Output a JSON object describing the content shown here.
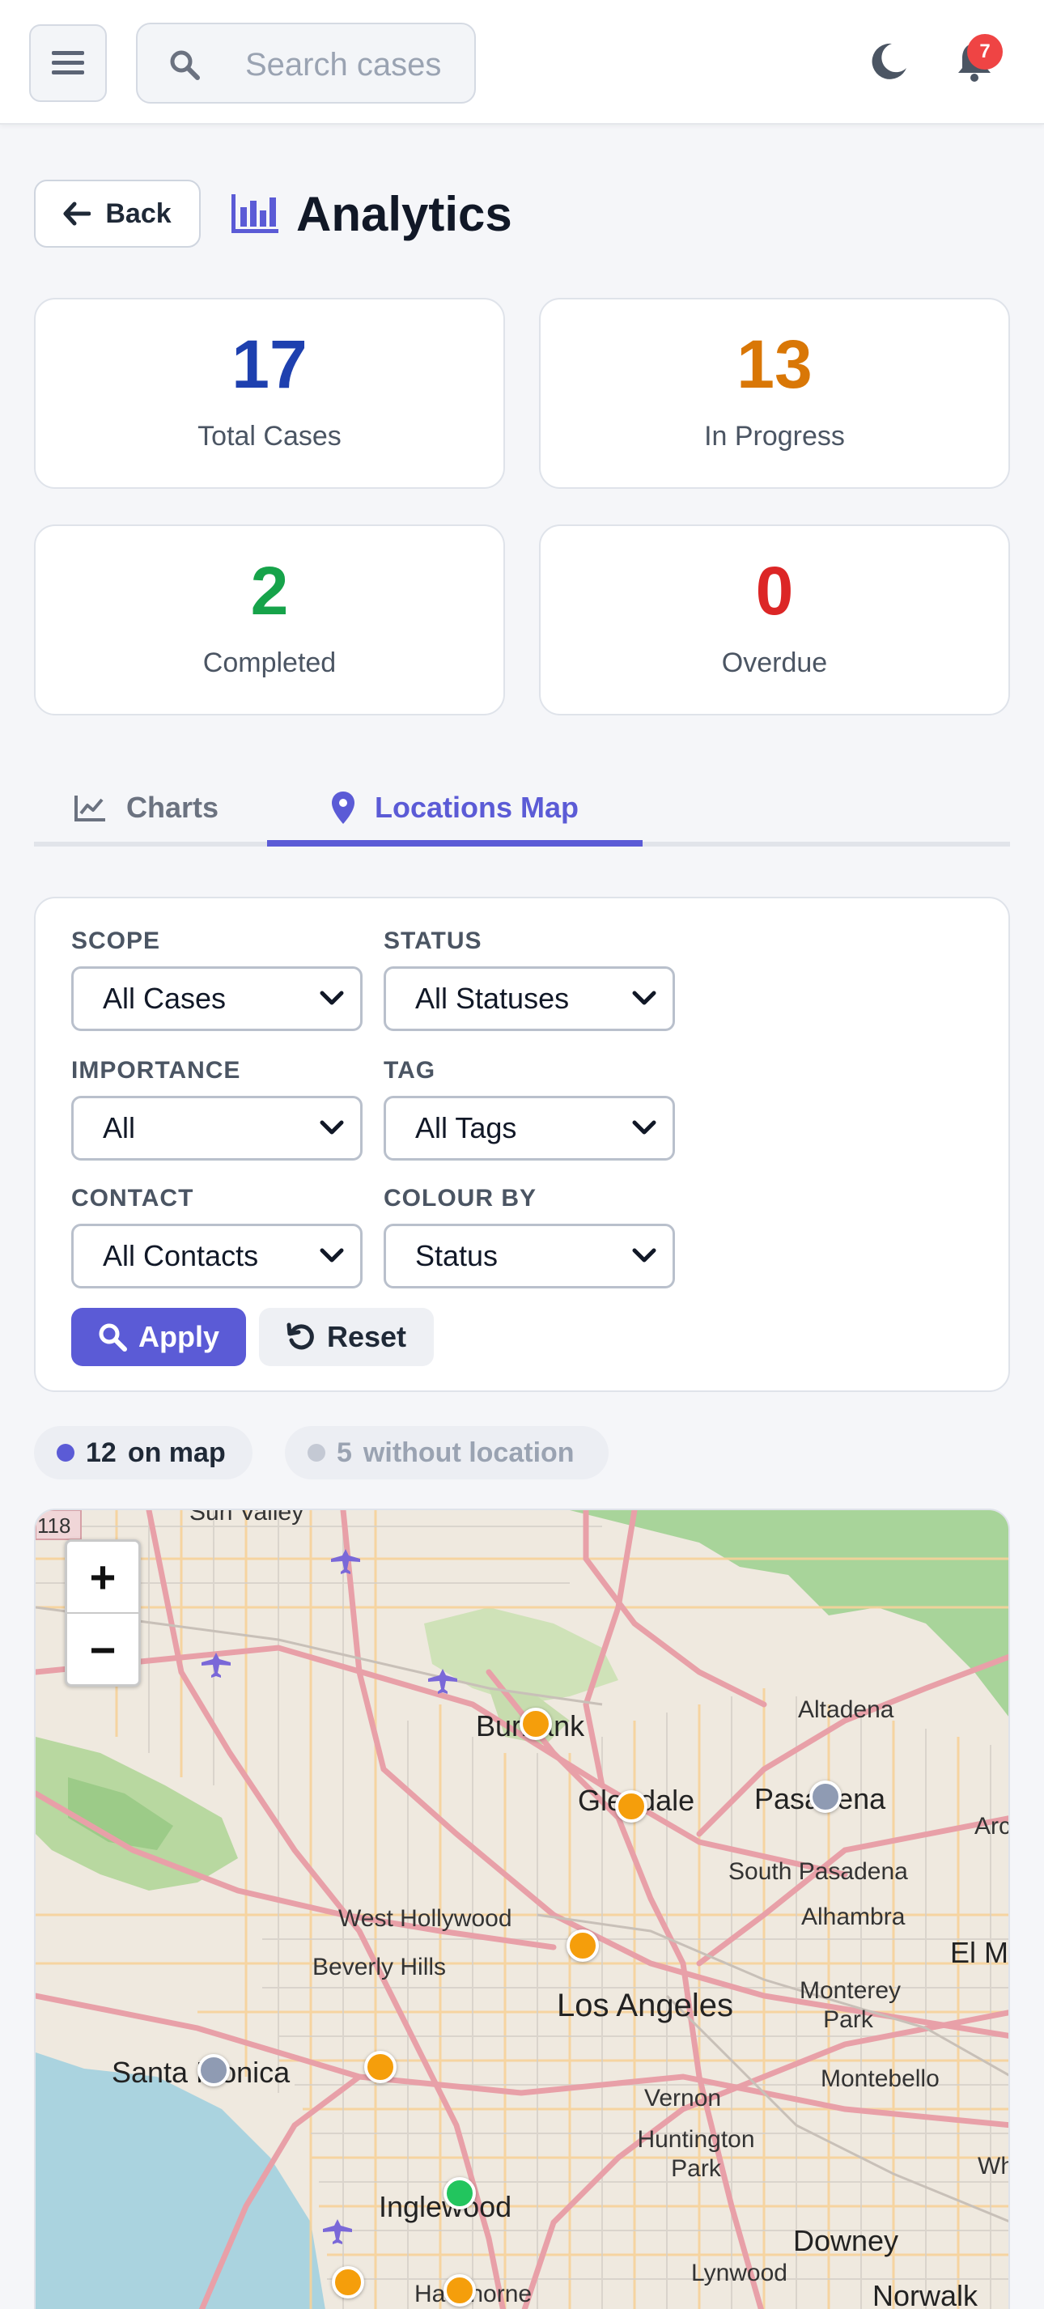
{
  "topbar": {
    "search_placeholder": "Search cases",
    "notification_count": "7"
  },
  "header": {
    "back_label": "Back",
    "title": "Analytics"
  },
  "stats": [
    {
      "value": "17",
      "label": "Total Cases",
      "color": "#1e40af"
    },
    {
      "value": "13",
      "label": "In Progress",
      "color": "#d97706"
    },
    {
      "value": "2",
      "label": "Completed",
      "color": "#16a34a"
    },
    {
      "value": "0",
      "label": "Overdue",
      "color": "#dc2626"
    }
  ],
  "tabs": [
    {
      "label": "Charts",
      "icon": "line-chart-icon",
      "active": false
    },
    {
      "label": "Locations Map",
      "icon": "map-pin-icon",
      "active": true
    }
  ],
  "filters": {
    "scope": {
      "label": "SCOPE",
      "value": "All Cases"
    },
    "status": {
      "label": "STATUS",
      "value": "All Statuses"
    },
    "importance": {
      "label": "IMPORTANCE",
      "value": "All"
    },
    "tag": {
      "label": "TAG",
      "value": "All Tags"
    },
    "contact": {
      "label": "CONTACT",
      "value": "All Contacts"
    },
    "colour_by": {
      "label": "COLOUR BY",
      "value": "Status"
    },
    "apply_label": "Apply",
    "reset_label": "Reset"
  },
  "map_summary": {
    "on_map_count": "12",
    "on_map_label": "on map",
    "without_count": "5",
    "without_label": "without location"
  },
  "map": {
    "zoom_in": "+",
    "zoom_out": "−",
    "shield": "118",
    "places": {
      "burbank": "Burbank",
      "glendale": "Glendale",
      "pasadena": "Pasadena",
      "altadena": "Altadena",
      "arcadia": "Arc",
      "south_pasadena": "South Pasadena",
      "alhambra": "Alhambra",
      "west_hollywood": "West Hollywood",
      "beverly_hills": "Beverly Hills",
      "los_angeles": "Los Angeles",
      "monterey_park": "Monterey Park",
      "el_monte": "El M",
      "santa_monica": "Santa Monica",
      "montebello": "Montebello",
      "vernon": "Vernon",
      "huntington_park": "Huntington Park",
      "inglewood": "Inglewood",
      "downey": "Downey",
      "lynwood": "Lynwood",
      "hawthorne": "Hawthorne",
      "norwalk": "Norwalk",
      "whittier": "Wh",
      "sun_valley": "Sun Valley"
    }
  },
  "colors": {
    "accent": "#5b5bd6",
    "in_progress": "#f59e0b",
    "completed": "#22c55e",
    "not_started": "#8f9bb3"
  }
}
